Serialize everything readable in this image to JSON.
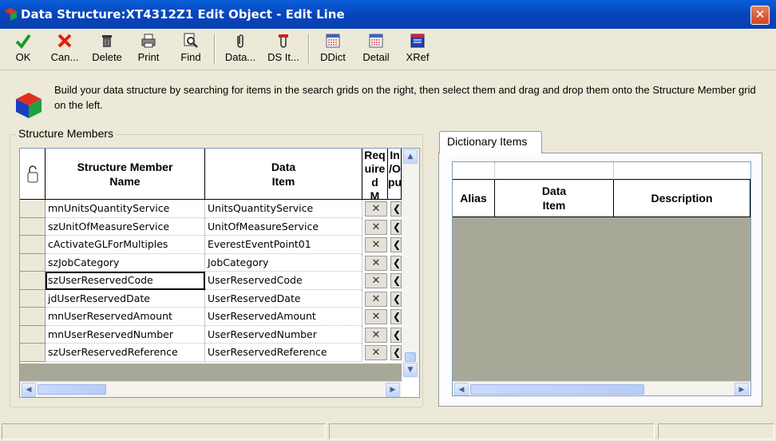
{
  "window": {
    "title": "Data Structure:XT4312Z1 Edit Object - Edit Line",
    "close_label": "✕"
  },
  "toolbar": {
    "ok": "OK",
    "cancel": "Can...",
    "delete": "Delete",
    "print": "Print",
    "find": "Find",
    "data": "Data...",
    "ds_item": "DS It...",
    "ddict": "DDict",
    "detail": "Detail",
    "xref": "XRef"
  },
  "info": {
    "text": "Build your data structure by searching for items in the search grids on the right, then select them and drag and drop them onto the Structure Member grid on the left."
  },
  "members": {
    "legend": "Structure Members",
    "headers": {
      "name": "Structure Member\nName",
      "data_item": "Data\nItem",
      "required": "Req\nuire\nd\nM",
      "io": "In\n/O\npu"
    },
    "rows": [
      {
        "name": "mnUnitsQuantityService",
        "item": "UnitsQuantityService"
      },
      {
        "name": "szUnitOfMeasureService",
        "item": "UnitOfMeasureService"
      },
      {
        "name": "cActivateGLForMultiples",
        "item": "EverestEventPoint01"
      },
      {
        "name": "szJobCategory",
        "item": "JobCategory"
      },
      {
        "name": "szUserReservedCode",
        "item": "UserReservedCode"
      },
      {
        "name": "jdUserReservedDate",
        "item": "UserReservedDate"
      },
      {
        "name": "mnUserReservedAmount",
        "item": "UserReservedAmount"
      },
      {
        "name": "mnUserReservedNumber",
        "item": "UserReservedNumber"
      },
      {
        "name": "szUserReservedReference",
        "item": "UserReservedReference"
      }
    ],
    "x_glyph": "✕",
    "c_glyph": "❮"
  },
  "dictionary": {
    "tab": "Dictionary Items",
    "headers": {
      "alias": "Alias",
      "data_item": "Data\nItem",
      "description": "Description"
    }
  },
  "colors": {
    "titlebar": "#0745BC",
    "face": "#ECE9D8",
    "grid_empty": "#A8A898"
  }
}
